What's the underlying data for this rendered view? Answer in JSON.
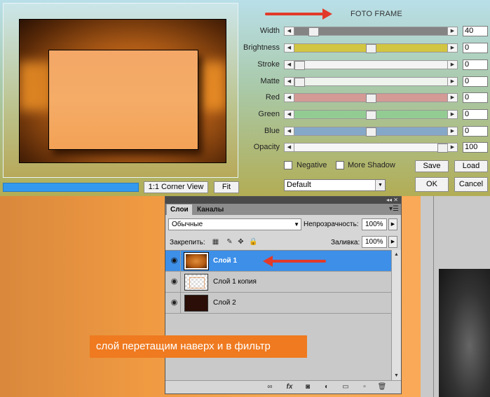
{
  "dialog": {
    "title": "FOTO FRAME",
    "corner_view_label": "1:1 Corner View",
    "fit_label": "Fit",
    "params": [
      {
        "label": "Width",
        "value": "40",
        "thumb_fraction": 0.1,
        "track_color": "#848484"
      },
      {
        "label": "Brightness",
        "value": "0",
        "thumb_fraction": 0.5,
        "track_color": "#d2c541"
      },
      {
        "label": "Stroke",
        "value": "0",
        "thumb_fraction": 0.0,
        "track_color": "#f4f4f4"
      },
      {
        "label": "Matte",
        "value": "0",
        "thumb_fraction": 0.0,
        "track_color": "#eef3ee"
      },
      {
        "label": "Red",
        "value": "0",
        "thumb_fraction": 0.5,
        "track_color": "#d49a95"
      },
      {
        "label": "Green",
        "value": "0",
        "thumb_fraction": 0.5,
        "track_color": "#93cc93"
      },
      {
        "label": "Blue",
        "value": "0",
        "thumb_fraction": 0.5,
        "track_color": "#86a8c8"
      },
      {
        "label": "Opacity",
        "value": "100",
        "thumb_fraction": 1.0,
        "track_color": "#f6f6f6"
      }
    ],
    "negative_label": "Negative",
    "more_shadow_label": "More Shadow",
    "save_label": "Save",
    "load_label": "Load",
    "ok_label": "OK",
    "cancel_label": "Cancel",
    "preset_value": "Default"
  },
  "layers_panel": {
    "tab_layers": "Слои",
    "tab_channels": "Каналы",
    "blend_mode": "Обычные",
    "opacity_label": "Непрозрачность:",
    "opacity_value": "100%",
    "lock_label": "Закрепить:",
    "fill_label": "Заливка:",
    "fill_value": "100%",
    "layers": [
      {
        "name": "Слой 1",
        "selected": true
      },
      {
        "name": "Слой 1 копия",
        "selected": false
      },
      {
        "name": "Слой 2",
        "selected": false
      }
    ]
  },
  "caption": "слой перетащим наверх и в фильтр",
  "colors": {
    "accent_red": "#e23a2a",
    "selection_blue": "#3d8fe8",
    "caption_bg": "#ef7a20"
  }
}
